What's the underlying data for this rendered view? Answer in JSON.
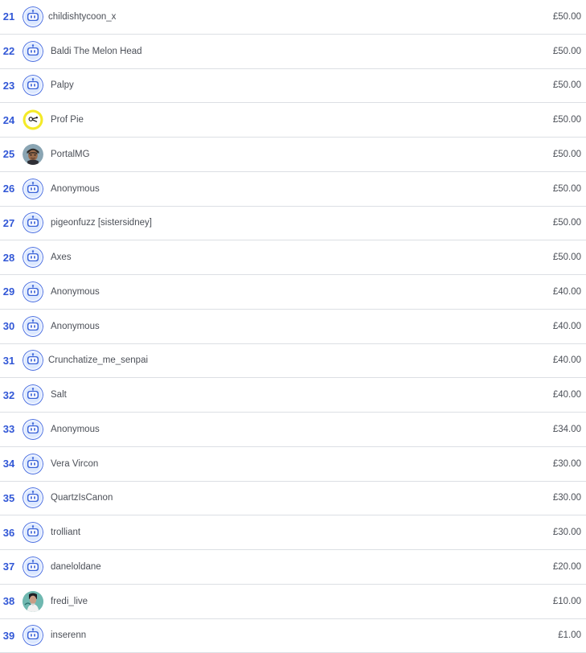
{
  "supporters": [
    {
      "rank": "21",
      "name": "childishtycoon_x",
      "amount": "£50.00",
      "avatar": "robot-avatar-icon"
    },
    {
      "rank": "22",
      "name": "Baldi The Melon Head",
      "amount": "£50.00",
      "avatar": "robot-avatar-icon"
    },
    {
      "rank": "23",
      "name": "Palpy",
      "amount": "£50.00",
      "avatar": "robot-avatar-icon"
    },
    {
      "rank": "24",
      "name": "Prof Pie",
      "amount": "£50.00",
      "avatar": "yellow-pie-avatar-icon"
    },
    {
      "rank": "25",
      "name": "PortalMG",
      "amount": "£50.00",
      "avatar": "character-avatar-icon"
    },
    {
      "rank": "26",
      "name": "Anonymous",
      "amount": "£50.00",
      "avatar": "robot-avatar-icon"
    },
    {
      "rank": "27",
      "name": "pigeonfuzz [sistersidney]",
      "amount": "£50.00",
      "avatar": "robot-avatar-icon"
    },
    {
      "rank": "28",
      "name": "Axes",
      "amount": "£50.00",
      "avatar": "robot-avatar-icon"
    },
    {
      "rank": "29",
      "name": "Anonymous",
      "amount": "£40.00",
      "avatar": "robot-avatar-icon"
    },
    {
      "rank": "30",
      "name": "Anonymous",
      "amount": "£40.00",
      "avatar": "robot-avatar-icon"
    },
    {
      "rank": "31",
      "name": "Crunchatize_me_senpai",
      "amount": "£40.00",
      "avatar": "robot-avatar-icon"
    },
    {
      "rank": "32",
      "name": "Salt",
      "amount": "£40.00",
      "avatar": "robot-avatar-icon"
    },
    {
      "rank": "33",
      "name": "Anonymous",
      "amount": "£34.00",
      "avatar": "robot-avatar-icon"
    },
    {
      "rank": "34",
      "name": "Vera Vircon",
      "amount": "£30.00",
      "avatar": "robot-avatar-icon"
    },
    {
      "rank": "35",
      "name": "QuartzIsCanon",
      "amount": "£30.00",
      "avatar": "robot-avatar-icon"
    },
    {
      "rank": "36",
      "name": "trolliant",
      "amount": "£30.00",
      "avatar": "robot-avatar-icon"
    },
    {
      "rank": "37",
      "name": "daneloldane",
      "amount": "£20.00",
      "avatar": "robot-avatar-icon"
    },
    {
      "rank": "38",
      "name": "fredi_live",
      "amount": "£10.00",
      "avatar": "photo-avatar-icon"
    },
    {
      "rank": "39",
      "name": "inserenn",
      "amount": "£1.00",
      "avatar": "robot-avatar-icon"
    }
  ],
  "colors": {
    "rank": "#3157d6",
    "divider": "#dcdfe4",
    "text": "#4b4f57",
    "robot_fill": "#eaf1ff",
    "robot_accent": "#3a63d8"
  }
}
